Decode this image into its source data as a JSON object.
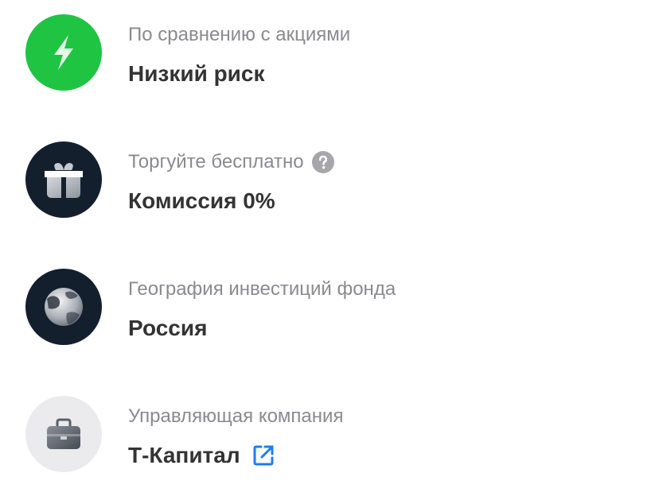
{
  "features": [
    {
      "icon": "lightning-icon",
      "icon_bg": "#1fc443",
      "caption": "По сравнению с акциями",
      "value": "Низкий риск"
    },
    {
      "icon": "gift-icon",
      "icon_bg": "#141f2e",
      "caption": "Торгуйте бесплатно",
      "caption_icon": "question-circle-icon",
      "value": "Комиссия 0%"
    },
    {
      "icon": "globe-icon",
      "icon_bg": "#141f2e",
      "caption": "География инвестиций фонда",
      "value": "Россия"
    },
    {
      "icon": "briefcase-icon",
      "icon_bg": "#ebebed",
      "caption": "Управляющая компания",
      "value": "Т-Капитал",
      "value_icon": "external-link-icon"
    }
  ],
  "colors": {
    "caption_text": "#8a8a8f",
    "value_text": "#333333",
    "link_accent": "#1b7ef0"
  }
}
